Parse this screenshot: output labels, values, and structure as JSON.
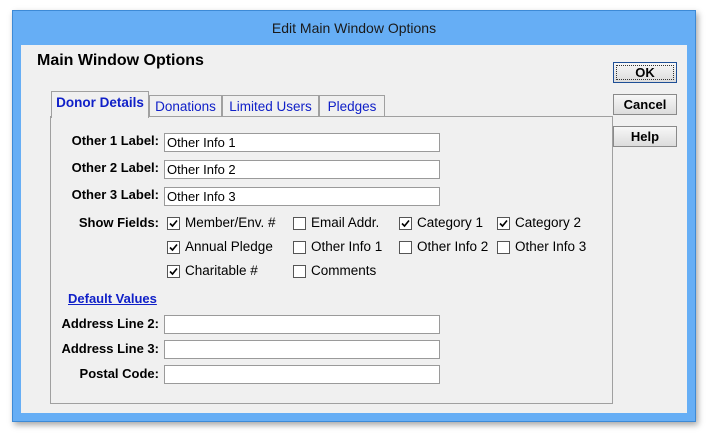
{
  "window": {
    "title": "Edit Main Window Options"
  },
  "heading": "Main Window Options",
  "buttons": {
    "ok": "OK",
    "cancel": "Cancel",
    "help": "Help"
  },
  "tabs": [
    "Donor Details",
    "Donations",
    "Limited Users",
    "Pledges"
  ],
  "active_tab": "Donor Details",
  "labels": {
    "other1": "Other 1 Label:",
    "other2": "Other 2 Label:",
    "other3": "Other 3 Label:",
    "show_fields": "Show Fields:",
    "default_values": "Default Values",
    "address2": "Address Line 2:",
    "address3": "Address Line 3:",
    "postal": "Postal Code:"
  },
  "values": {
    "other1": "Other Info 1",
    "other2": "Other Info 2",
    "other3": "Other Info 3",
    "address2": "",
    "address3": "",
    "postal": ""
  },
  "checkboxes": [
    {
      "label": "Member/Env. #",
      "checked": true
    },
    {
      "label": "Email Addr.",
      "checked": false
    },
    {
      "label": "Category 1",
      "checked": true
    },
    {
      "label": "Category 2",
      "checked": true
    },
    {
      "label": "Annual Pledge",
      "checked": true
    },
    {
      "label": "Other Info 1",
      "checked": false
    },
    {
      "label": "Other Info 2",
      "checked": false
    },
    {
      "label": "Other Info 3",
      "checked": false
    },
    {
      "label": "Charitable #",
      "checked": true
    },
    {
      "label": "Comments",
      "checked": false
    }
  ],
  "icons": {
    "checkmark": "check-icon"
  }
}
